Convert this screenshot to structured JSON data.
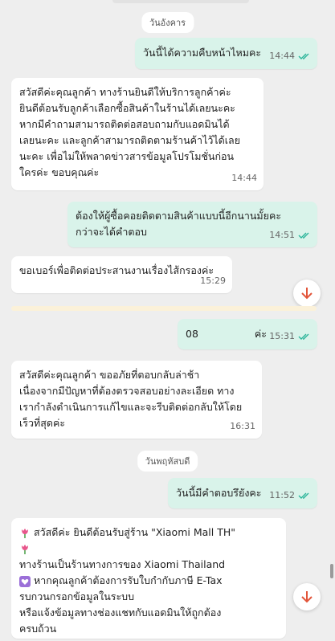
{
  "days": {
    "tuesday": "วันอังคาร",
    "thursday": "วันพฤหัสบดี"
  },
  "messages": {
    "m1": {
      "text": "วันนี้ได้ความคืบหน้าไหมคะ",
      "time": "14:44"
    },
    "m2": {
      "lines": [
        "สวัสดีค่ะคุณลูกค้า ทางร้านยินดีให้บริการลูกค้าค่ะ",
        "ยินดีต้อนรับลูกค้าเลือกซื้อสินค้าในร้านได้เลยนะคะ",
        "หากมีคำถามสามารถติดต่อสอบถามกับแอดมินได้",
        "เลยนะคะ และลูกค้าสามารถติดตามร้านค้าไว้ได้เลย",
        "นะคะ เพื่อไม่ให้พลาดข่าวสารข้อมูลโปรโมชั่นก่อน",
        "ใครค่ะ ขอบคุณค่ะ"
      ],
      "time": "14:44"
    },
    "m3": {
      "lines": [
        "ต้องให้ผู้ซื้อคอยติดตามสินค้าแบบนี้อีกนานมั้ยคะ",
        "กว่าจะได้คำตอบ"
      ],
      "time": "14:51"
    },
    "m4": {
      "text": "ขอเบอร์เพื่อติดต่อประสานงานเรื่องไส้กรองค่ะ",
      "time": "15:29"
    },
    "m5": {
      "prefix": "08",
      "suffix": "ค่ะ",
      "time": "15:31"
    },
    "m6": {
      "lines": [
        "สวัสดีค่ะคุณลูกค้า ขออภัยที่ตอบกลับล่าช้า",
        "เนื่องจากมีปัญหาที่ต้องตรวจสอบอย่างละเอียด ทาง",
        "เรากำลังดำเนินการแก้ไขและจะรีบติดต่อกลับให้โดย",
        "เร็วที่สุดค่ะ"
      ],
      "time": "16:31"
    },
    "m7": {
      "text": "วันนี้มีคำตอบรึยังคะ",
      "time": "11:52"
    },
    "m8": {
      "lines": [
        "สวัสดีค่ะ ยินดีต้อนรับสู่ร้าน \"Xiaomi Mall TH\"",
        "",
        "ทางร้านเป็นร้านทางการของ Xiaomi Thailand",
        "หากคุณลูกค้าต้องการรับใบกำกับภาษี E-Tax",
        "รบกวนกรอกข้อมูลในระบบ",
        "หรือแจ้งข้อมูลทางช่องแชทกับแอดมินให้ถูกต้อง",
        "ครบถ้วน"
      ]
    }
  },
  "icons": {
    "read": "double-check-icon",
    "scroll": "arrow-down-icon",
    "flower": "tulip-icon",
    "heart": "heart-icon"
  },
  "colors": {
    "incoming": "#ffffff",
    "outgoing": "#d9f3ea",
    "tick": "#2bb59a",
    "arrow": "#e2553a"
  }
}
